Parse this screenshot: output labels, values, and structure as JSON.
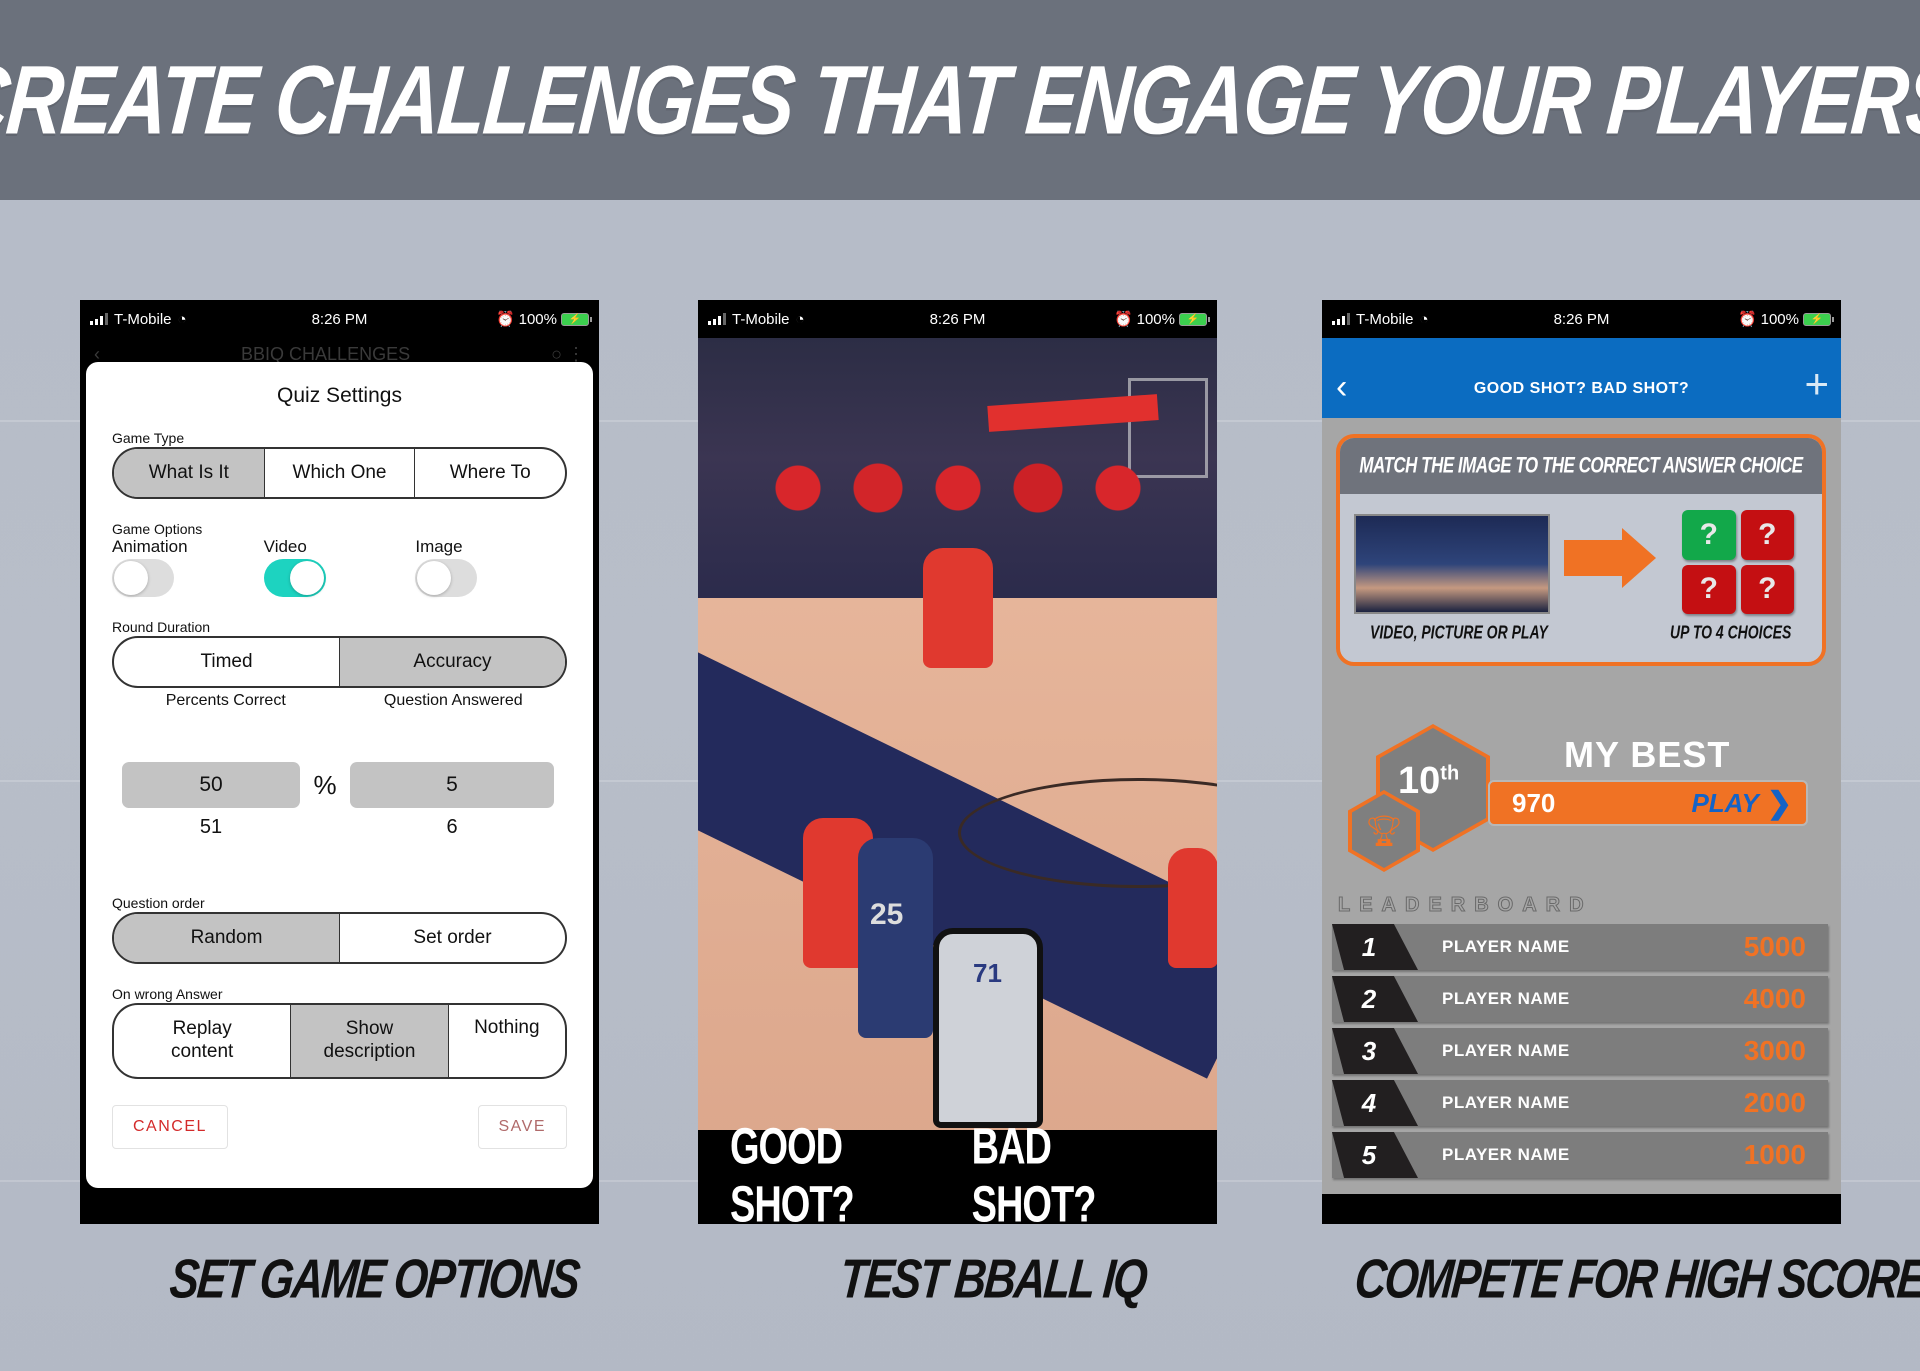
{
  "headline": "CREATE CHALLENGES THAT ENGAGE YOUR PLAYERS",
  "captions": [
    "SET GAME OPTIONS",
    "TEST BBALL IQ",
    "COMPETE FOR HIGH SCORE"
  ],
  "status_bar": {
    "carrier": "T-Mobile",
    "time": "8:26 PM",
    "battery": "100%"
  },
  "colors": {
    "accent_teal": "#1dd3c0",
    "brand_blue": "#0b6cc1",
    "brand_orange": "#f07224",
    "cancel_red": "#d32a2a"
  },
  "phone1": {
    "nav_title": "BBIQ CHALLENGES",
    "dialog": {
      "title": "Quiz Settings",
      "game_type": {
        "label": "Game Type",
        "options": [
          "What Is It",
          "Which One",
          "Where To"
        ],
        "selected": "What Is It"
      },
      "game_options": {
        "label": "Game Options",
        "toggles": [
          {
            "label": "Animation",
            "on": false
          },
          {
            "label": "Video",
            "on": true
          },
          {
            "label": "Image",
            "on": false
          }
        ]
      },
      "round_duration": {
        "label": "Round Duration",
        "options": [
          "Timed",
          "Accuracy"
        ],
        "selected": "Accuracy",
        "sub_labels": [
          "Percents Correct",
          "Question Answered"
        ]
      },
      "percent_value": "50",
      "percent_symbol": "%",
      "questions_value": "5",
      "percent_next": "51",
      "questions_next": "6",
      "question_order": {
        "label": "Question order",
        "options": [
          "Random",
          "Set order"
        ],
        "selected": "Random"
      },
      "on_wrong_answer": {
        "label": "On wrong Answer",
        "options": [
          "Replay content",
          "Show description",
          "Nothing"
        ],
        "selected": "Show description"
      },
      "cancel_label": "CANCEL",
      "save_label": "SAVE"
    }
  },
  "phone2": {
    "jersey_number": "25",
    "referee_number": "71",
    "good_shot": "GOOD SHOT?",
    "bad_shot": "BAD SHOT?"
  },
  "phone3": {
    "header_title": "GOOD SHOT?  BAD SHOT?",
    "promo": {
      "title": "MATCH THE IMAGE TO THE CORRECT ANSWER CHOICE",
      "left_caption": "VIDEO, PICTURE OR PLAY",
      "right_caption": "UP TO 4 CHOICES",
      "choices": [
        "?",
        "?",
        "?",
        "?"
      ]
    },
    "rank": "10",
    "rank_suffix": "th",
    "my_best_label": "MY BEST",
    "my_best_score": "970",
    "play_label": "PLAY",
    "leaderboard_title": "LEADERBOARD",
    "leaderboard": [
      {
        "rank": "1",
        "name": "PLAYER NAME",
        "score": "5000"
      },
      {
        "rank": "2",
        "name": "PLAYER NAME",
        "score": "4000"
      },
      {
        "rank": "3",
        "name": "PLAYER NAME",
        "score": "3000"
      },
      {
        "rank": "4",
        "name": "PLAYER NAME",
        "score": "2000"
      },
      {
        "rank": "5",
        "name": "PLAYER NAME",
        "score": "1000"
      }
    ]
  }
}
